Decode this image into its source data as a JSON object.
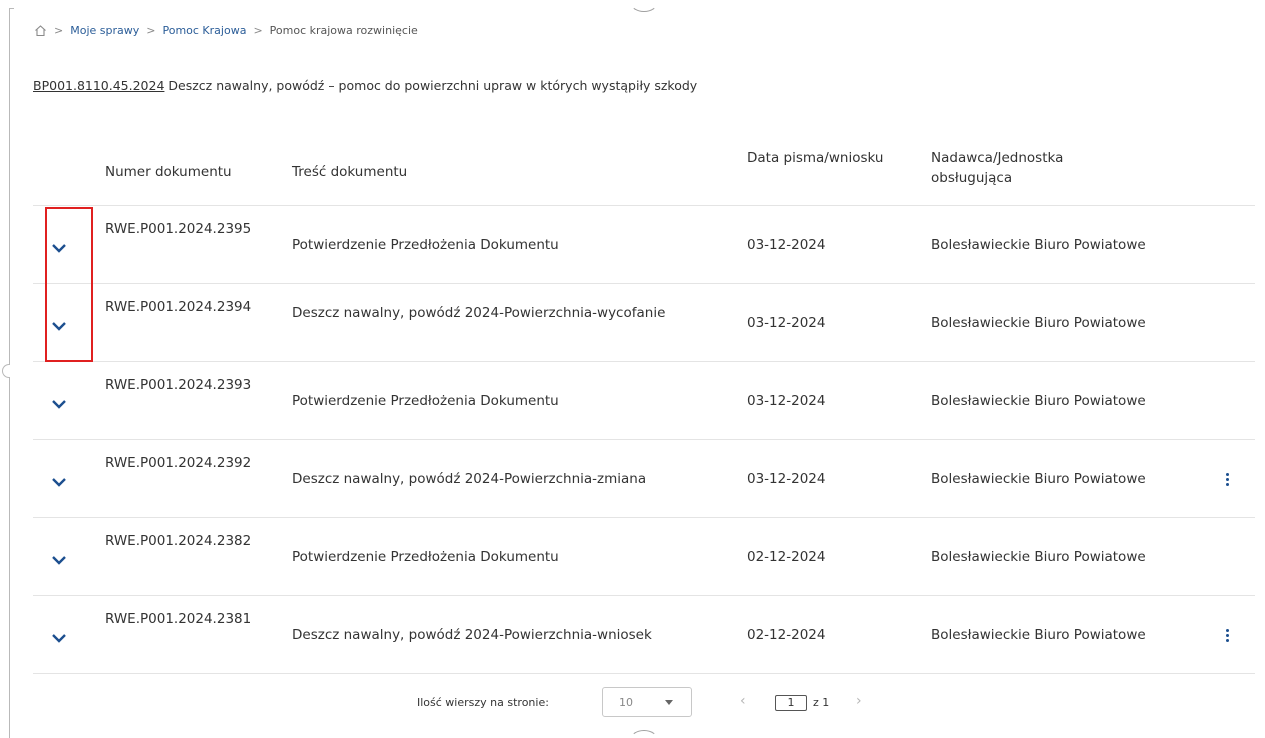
{
  "breadcrumb": {
    "home_icon": "home-icon",
    "separator": ">",
    "items": [
      "Moje sprawy",
      "Pomoc Krajowa",
      "Pomoc krajowa rozwinięcie"
    ]
  },
  "case": {
    "number": "BP001.8110.45.2024",
    "title": "Deszcz nawalny, powódź – pomoc do powierzchni upraw w których wystąpiły szkody"
  },
  "table": {
    "columns": {
      "number": "Numer dokumentu",
      "content": "Treść dokumentu",
      "date": "Data pisma/wniosku",
      "sender": "Nadawca/Jednostka obsługująca"
    },
    "rows": [
      {
        "number": "RWE.P001.2024.2395",
        "content": "Potwierdzenie Przedłożenia Dokumentu",
        "date": "03-12-2024",
        "sender": "Bolesławieckie Biuro Powiatowe"
      },
      {
        "number": "RWE.P001.2024.2394",
        "content": "Deszcz nawalny, powódź 2024-Powierzchnia-wycofanie",
        "date": "03-12-2024",
        "sender": "Bolesławieckie Biuro Powiatowe"
      },
      {
        "number": "RWE.P001.2024.2393",
        "content": "Potwierdzenie Przedłożenia Dokumentu",
        "date": "03-12-2024",
        "sender": "Bolesławieckie Biuro Powiatowe"
      },
      {
        "number": "RWE.P001.2024.2392",
        "content": "Deszcz nawalny, powódź 2024-Powierzchnia-zmiana",
        "date": "03-12-2024",
        "sender": "Bolesławieckie Biuro Powiatowe"
      },
      {
        "number": "RWE.P001.2024.2382",
        "content": "Potwierdzenie Przedłożenia Dokumentu",
        "date": "02-12-2024",
        "sender": "Bolesławieckie Biuro Powiatowe"
      },
      {
        "number": "RWE.P001.2024.2381",
        "content": "Deszcz nawalny, powódź 2024-Powierzchnia-wniosek",
        "date": "02-12-2024",
        "sender": "Bolesławieckie Biuro Powiatowe"
      }
    ],
    "expand_icon": "chevron-down-icon",
    "row_menu_icon": "more-vertical-icon"
  },
  "pagination": {
    "rows_per_page_label": "Ilość wierszy na stronie:",
    "rows_per_page_value": "10",
    "current_page": "1",
    "of_label": "z 1",
    "prev_icon": "chevron-left-icon",
    "next_icon": "chevron-right-icon"
  },
  "colors": {
    "link": "#2b5d98",
    "chevron": "#1c4f8f",
    "highlight": "#e02020",
    "divider": "#e4e4e4"
  }
}
